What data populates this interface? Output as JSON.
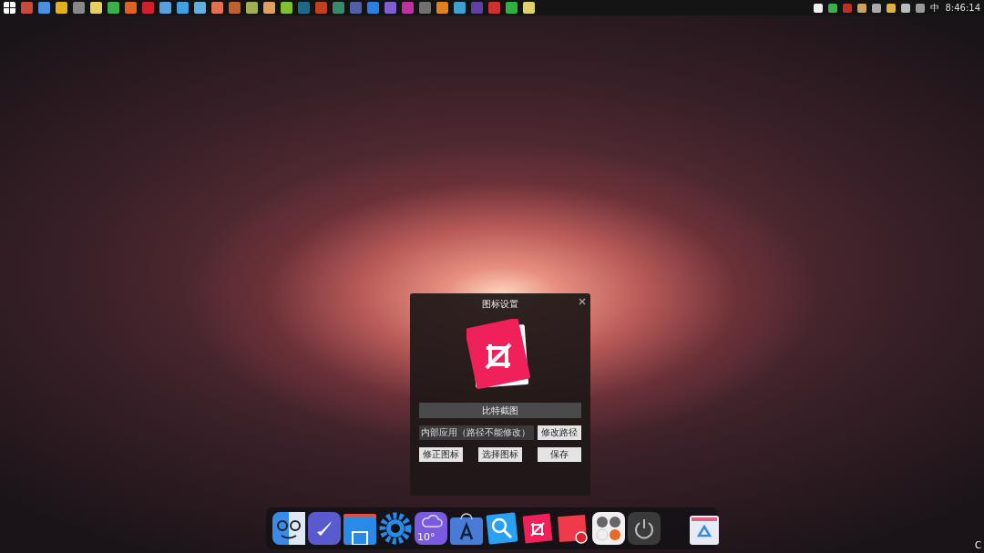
{
  "taskbar": {
    "input_method": "中",
    "clock": "8:46:14"
  },
  "dialog": {
    "title": "图标设置",
    "app_name": "比特截图",
    "path_field": {
      "value": "内部应用（路径不能修改）"
    },
    "buttons": [
      {
        "label": "修改路径"
      },
      {
        "label": "修正图标"
      },
      {
        "label": "选择图标"
      },
      {
        "label": "保存"
      }
    ]
  },
  "dock": {
    "weather_temp": "10°"
  },
  "corner_text": "C"
}
